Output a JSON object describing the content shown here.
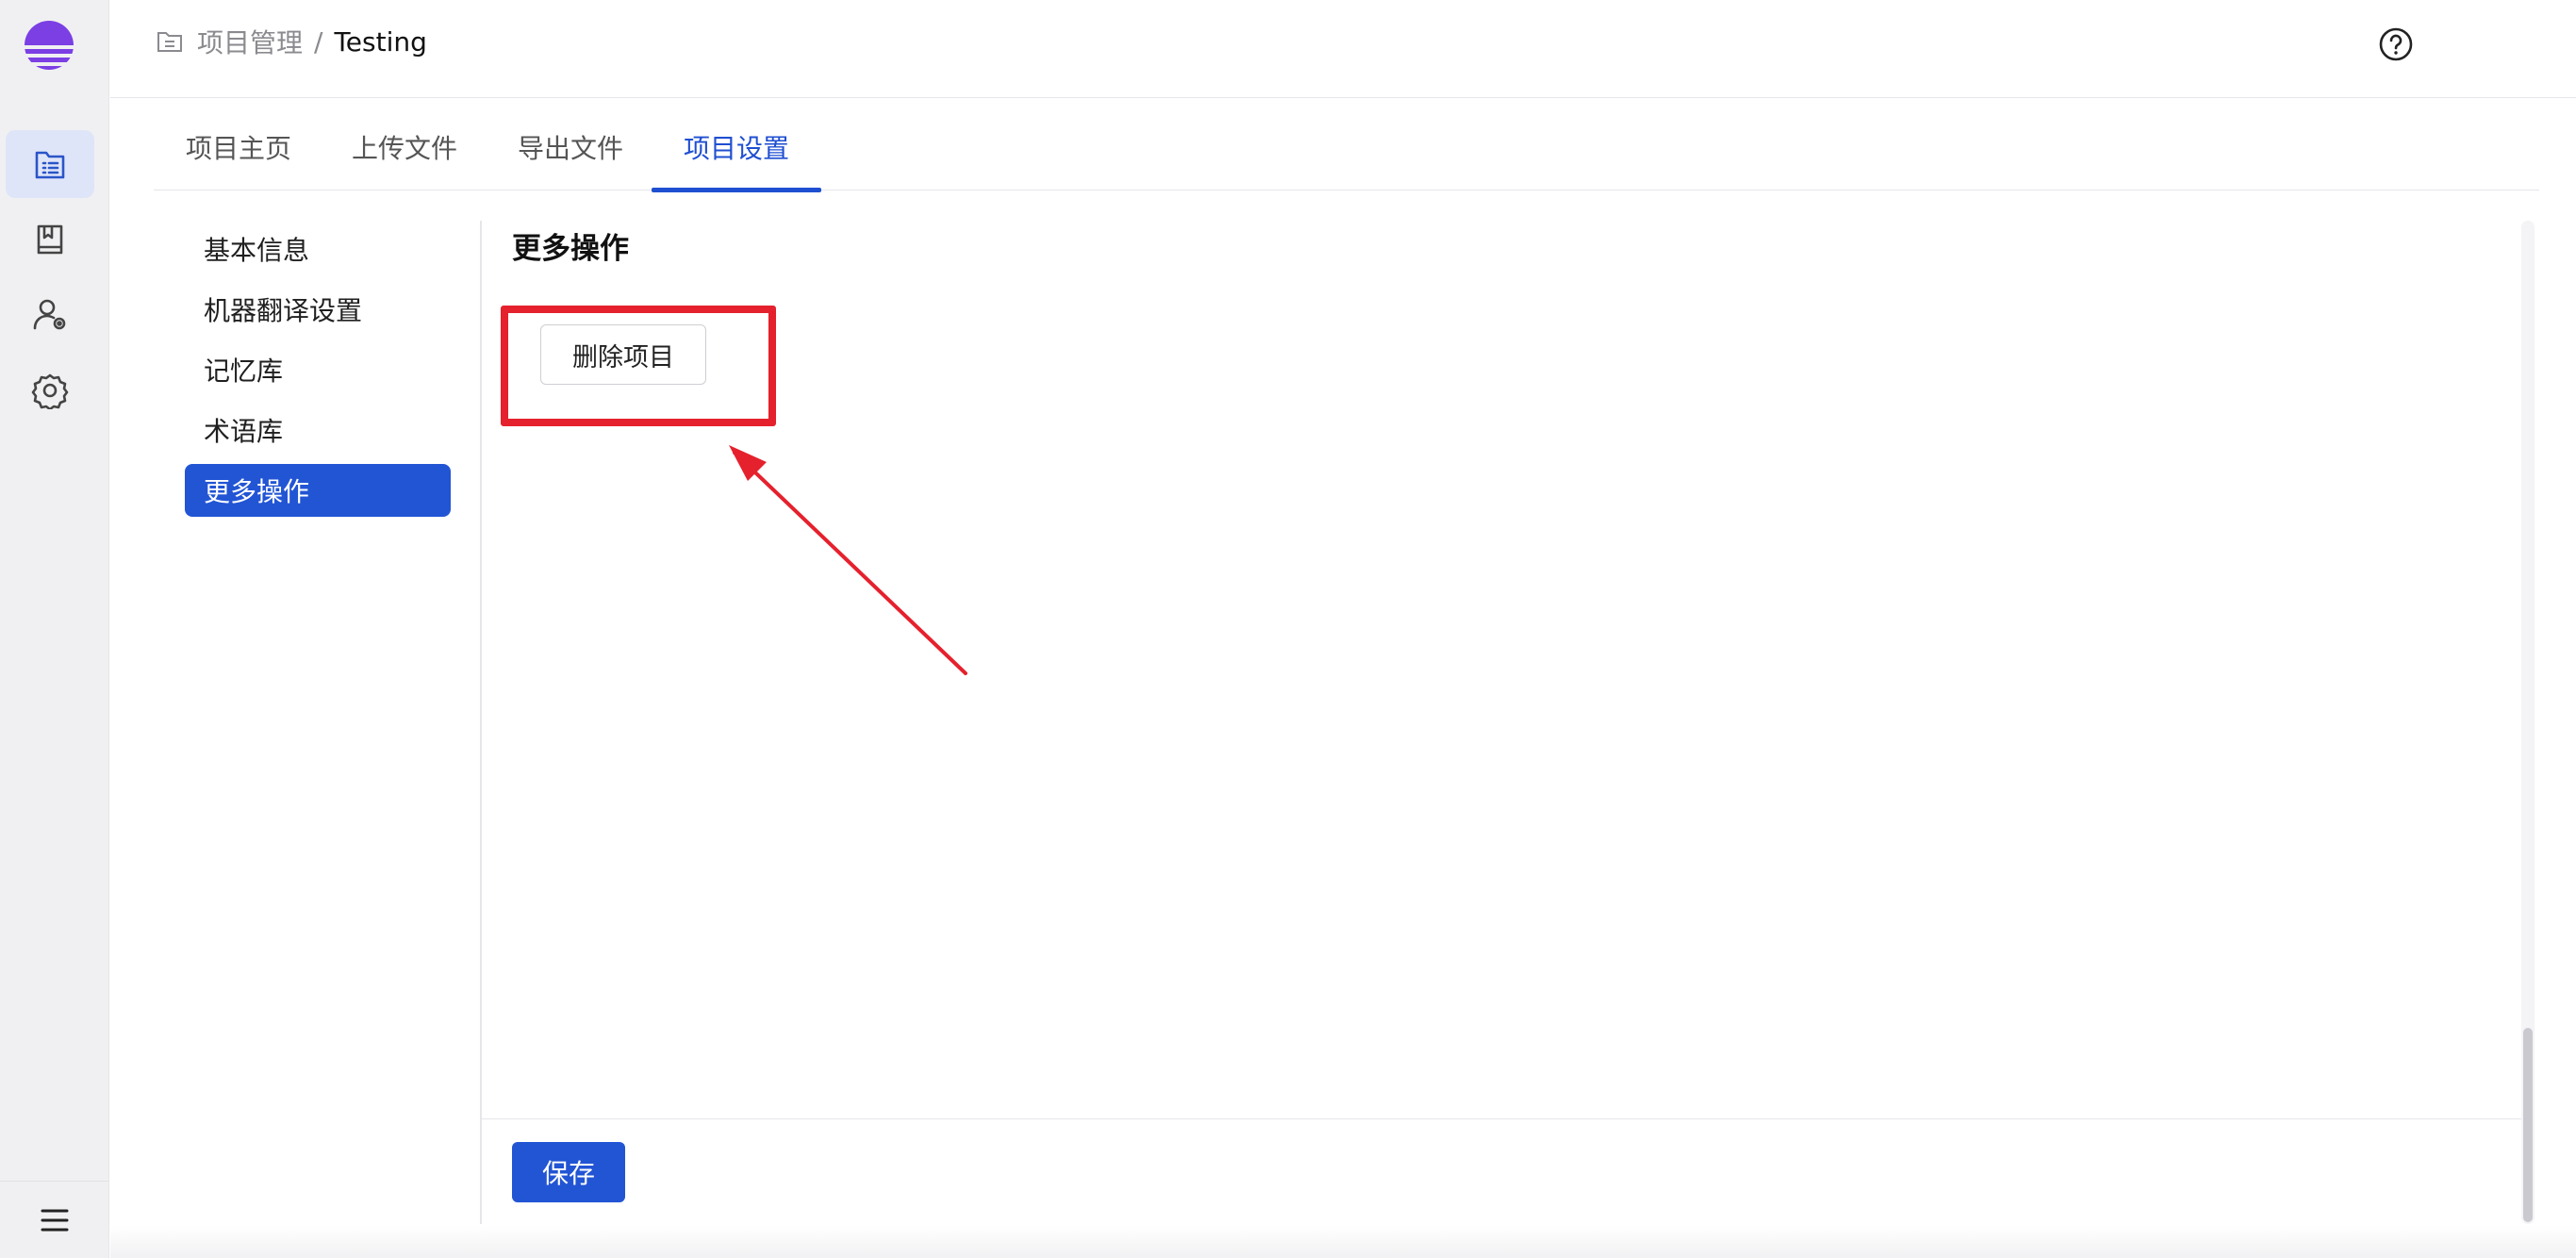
{
  "breadcrumb": {
    "root": "项目管理",
    "separator": "/",
    "current": "Testing"
  },
  "tabs": [
    {
      "label": "项目主页"
    },
    {
      "label": "上传文件"
    },
    {
      "label": "导出文件"
    },
    {
      "label": "项目设置"
    }
  ],
  "active_tab": "项目设置",
  "settings_menu": [
    {
      "label": "基本信息"
    },
    {
      "label": "机器翻译设置"
    },
    {
      "label": "记忆库"
    },
    {
      "label": "术语库"
    },
    {
      "label": "更多操作"
    }
  ],
  "active_menu": "更多操作",
  "section": {
    "title": "更多操作",
    "delete_button": "删除项目"
  },
  "footer": {
    "save_button": "保存"
  },
  "colors": {
    "primary": "#2255d4",
    "annotation": "#e5212d",
    "logo": "#7b3fe4"
  },
  "icons": {
    "rail": [
      "list-document-icon",
      "book-icon",
      "user-settings-icon",
      "gear-icon",
      "menu-icon"
    ],
    "header": [
      "folder-icon",
      "help-icon",
      "avatar"
    ]
  }
}
